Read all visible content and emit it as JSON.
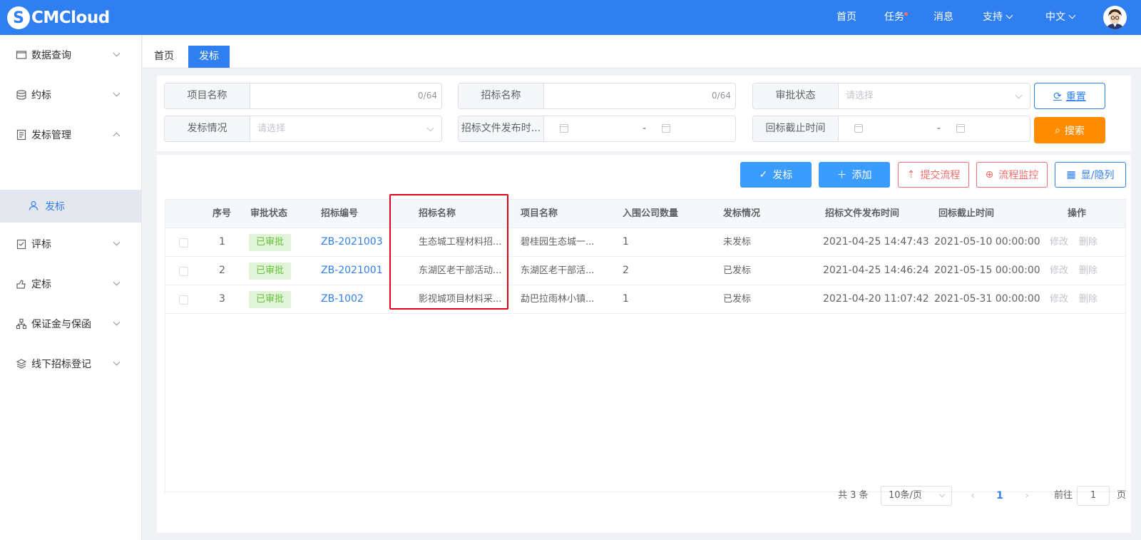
{
  "app": {
    "logo_mark": "S",
    "logo_text": "CMCloud"
  },
  "topnav": {
    "home": "首页",
    "tasks": "任务",
    "messages": "消息",
    "support": "支持",
    "language": "中文"
  },
  "sidebar": {
    "items": [
      {
        "label": "数据查询"
      },
      {
        "label": "约标"
      },
      {
        "label": "发标管理"
      },
      {
        "label": "评标"
      },
      {
        "label": "定标"
      },
      {
        "label": "保证金与保函"
      },
      {
        "label": "线下招标登记"
      }
    ],
    "sub_active": "发标"
  },
  "tabs": {
    "home": "首页",
    "active": "发标"
  },
  "filters": {
    "project_name": {
      "label": "项目名称",
      "count": "0/64"
    },
    "tender_name": {
      "label": "招标名称",
      "count": "0/64"
    },
    "approval_status": {
      "label": "审批状态",
      "placeholder": "请选择"
    },
    "publish_status": {
      "label": "发标情况",
      "placeholder": "请选择"
    },
    "doc_publish_time": {
      "label": "招标文件发布时...",
      "sep": "-"
    },
    "bid_deadline": {
      "label": "回标截止时间",
      "sep": "-"
    },
    "reset": "重置",
    "search": "搜索"
  },
  "toolbar": {
    "publish": "发标",
    "add": "添加",
    "submit_flow": "提交流程",
    "flow_monitor": "流程监控",
    "toggle_columns": "显/隐列"
  },
  "table": {
    "headers": [
      "序号",
      "审批状态",
      "招标编号",
      "招标名称",
      "项目名称",
      "入围公司数量",
      "发标情况",
      "招标文件发布时间",
      "回标截止时间",
      "操作"
    ],
    "rows": [
      {
        "no": "1",
        "status": "已审批",
        "code": "ZB-2021003",
        "tender": "生态城工程材料招...",
        "project": "碧桂园生态城一...",
        "count": "1",
        "publish": "未发标",
        "doc_time": "2021-04-25 14:47:43",
        "deadline": "2021-05-10 00:00:00",
        "edit": "修改",
        "delete": "删除"
      },
      {
        "no": "2",
        "status": "已审批",
        "code": "ZB-2021001",
        "tender": "东湖区老干部活动...",
        "project": "东湖区老干部活...",
        "count": "2",
        "publish": "已发标",
        "doc_time": "2021-04-25 14:46:24",
        "deadline": "2021-05-15 00:00:00",
        "edit": "修改",
        "delete": "删除"
      },
      {
        "no": "3",
        "status": "已审批",
        "code": "ZB-1002",
        "tender": "影视城项目材料采...",
        "project": "勐巴拉雨林小镇...",
        "count": "1",
        "publish": "已发标",
        "doc_time": "2021-04-20 11:07:42",
        "deadline": "2021-05-31 00:00:00",
        "edit": "修改",
        "delete": "删除"
      }
    ]
  },
  "pagination": {
    "total": "共 3 条",
    "page_size": "10条/页",
    "current": "1",
    "goto_prefix": "前往",
    "goto_value": "1",
    "goto_suffix": "页"
  },
  "colors": {
    "primary": "#2f7ff0",
    "orange": "#ff8c00",
    "danger": "#f56c6c",
    "success": "#67c23a",
    "highlight": "#e0001a"
  }
}
